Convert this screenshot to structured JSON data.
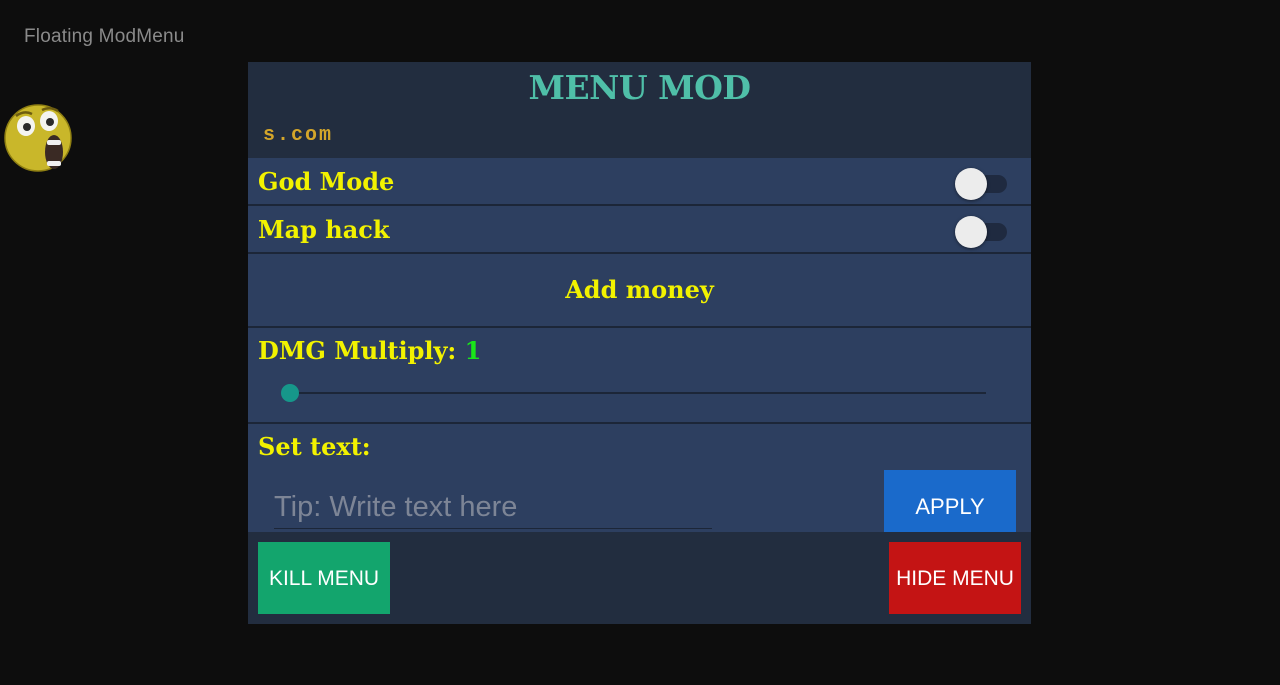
{
  "app": {
    "title": "Floating ModMenu"
  },
  "floating_icon": {
    "icon": "surprised-face-icon"
  },
  "menu": {
    "title": "MENU MOD",
    "subtitle": "s.com",
    "colors": {
      "background": "#222d3f",
      "row": "#2d3f60",
      "title": "#4fbfa8",
      "subtitle": "#d4a62a",
      "label": "#f2f200",
      "value": "#19e619"
    },
    "toggles": [
      {
        "label": "God Mode",
        "on": false
      },
      {
        "label": "Map hack",
        "on": false
      }
    ],
    "add_money": {
      "label": "Add money"
    },
    "slider": {
      "label": "DMG Multiply: ",
      "value": "1"
    },
    "text_setter": {
      "label": "Set text:",
      "placeholder": "Tip: Write text here",
      "value": "",
      "apply_label": "APPLY"
    }
  },
  "footer": {
    "kill_label": "KILL MENU",
    "hide_label": "HIDE MENU",
    "colors": {
      "kill": "#13a56d",
      "hide": "#c41414",
      "apply": "#1a6acb"
    }
  }
}
